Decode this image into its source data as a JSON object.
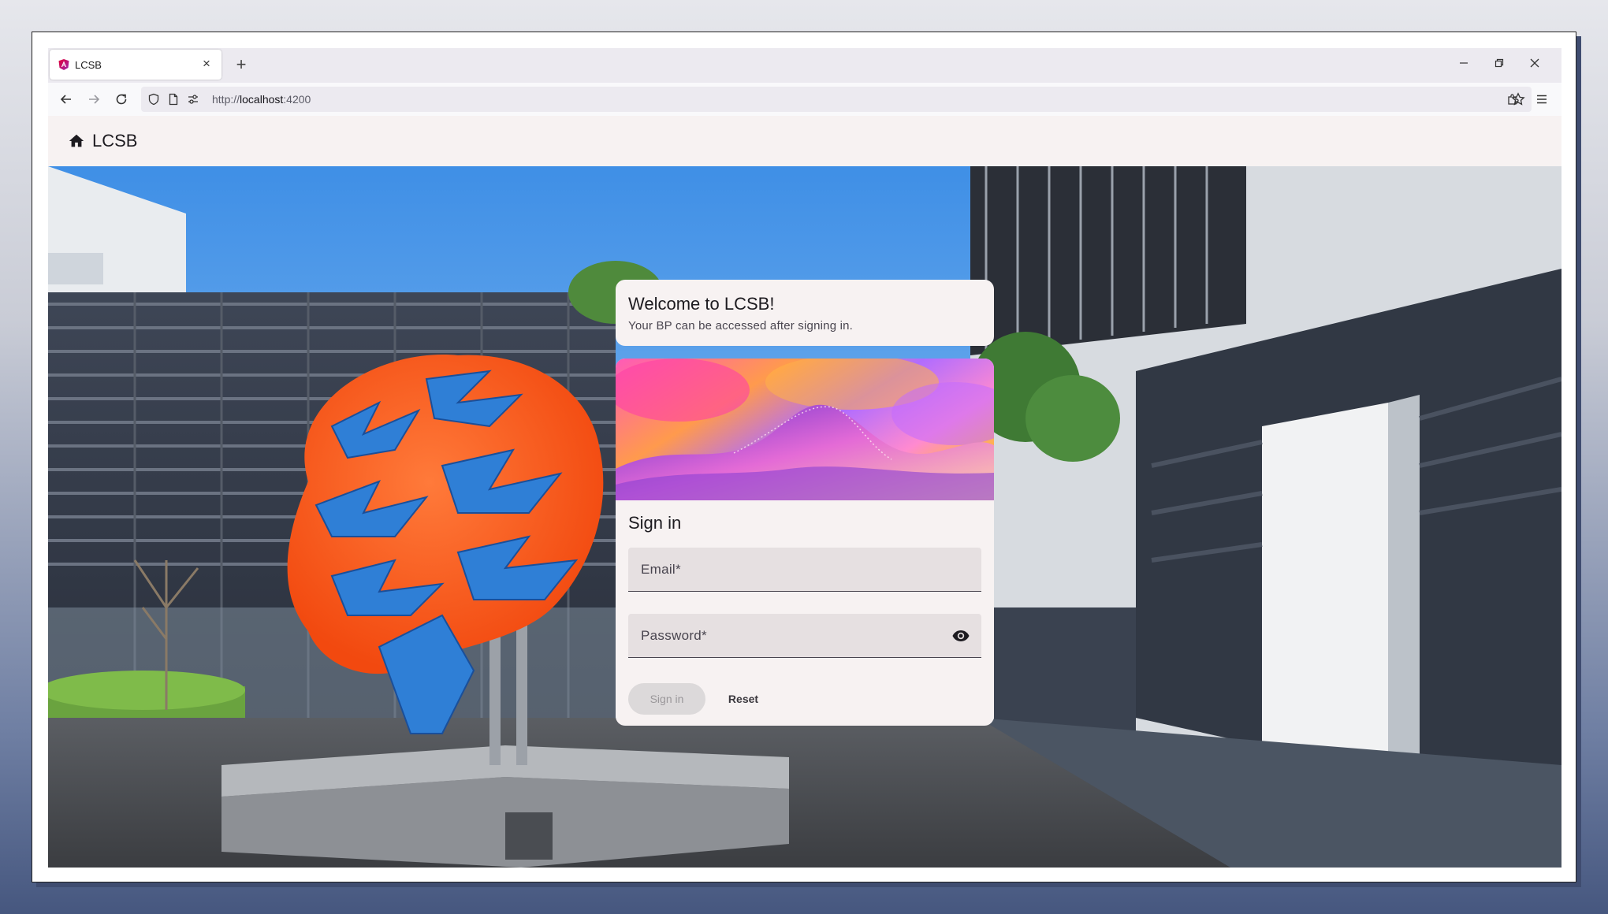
{
  "browser": {
    "tab_title": "LCSB",
    "new_tab_symbol": "+",
    "close_tab_symbol": "×",
    "url_scheme": "http://",
    "url_host": "localhost",
    "url_port": ":4200",
    "window_controls": {
      "minimize": "—",
      "restore": "❐",
      "close": "✕"
    }
  },
  "app": {
    "toolbar_title": "LCSB",
    "home_icon": "home-icon"
  },
  "welcome": {
    "title": "Welcome to LCSB!",
    "subtitle": "Your BP can be accessed after signing in."
  },
  "signin": {
    "title": "Sign in",
    "email_label": "Email*",
    "password_label": "Password*",
    "submit_label": "Sign in",
    "reset_label": "Reset",
    "submit_enabled": false
  },
  "colors": {
    "toolbar_bg": "#f7f2f2",
    "field_bg": "#e6e0e1",
    "brain_orange": "#ff5a1f",
    "brain_blue": "#2f7fd6"
  }
}
